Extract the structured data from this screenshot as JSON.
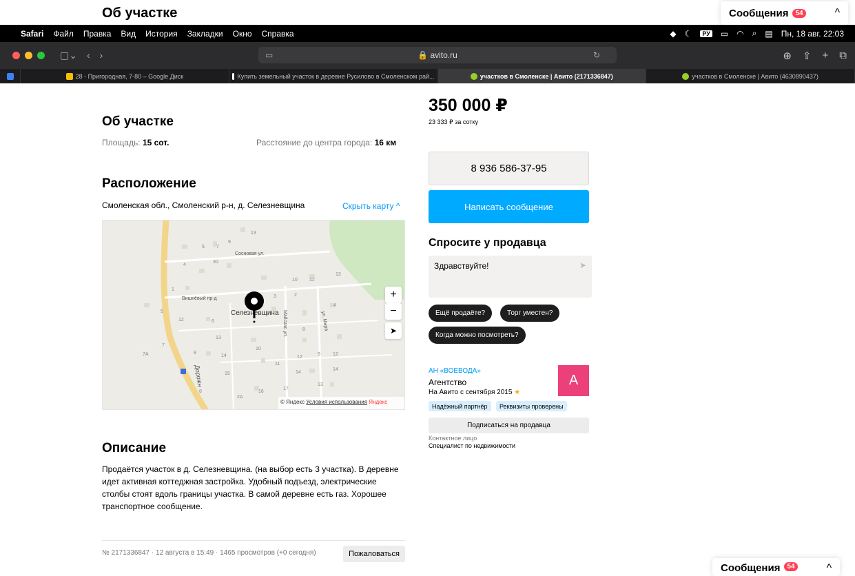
{
  "sticky_header": {
    "title": "Об участке",
    "messages_label": "Сообщения",
    "messages_count": "54",
    "collapse_icon": "chevron-up-icon"
  },
  "menubar": {
    "apple_icon": "apple-icon",
    "app": "Safari",
    "items": [
      "Файл",
      "Правка",
      "Вид",
      "История",
      "Закладки",
      "Окно",
      "Справка"
    ],
    "input_lang": "РУ",
    "datetime": "Пн, 18 авг. 22:03"
  },
  "toolbar": {
    "url": "avito.ru",
    "colors": {
      "close": "#ff5f57",
      "minimize": "#febc2e",
      "zoom": "#28c840"
    }
  },
  "tabs": [
    {
      "label": "28 - Пригородная, 7-80 – Google Диск",
      "active": false
    },
    {
      "label": "Купить земельный участок в деревне Русилово в Смоленском рай...",
      "active": false
    },
    {
      "label": "участков в Смоленске | Авито (2171336847)",
      "active": true
    },
    {
      "label": "участков в Смоленске | Авито (4630890437)",
      "active": false
    }
  ],
  "about": {
    "title": "Об участке",
    "area_label": "Площадь:",
    "area_value": "15 сот.",
    "distance_label": "Расстояние до центра города:",
    "distance_value": "16 км"
  },
  "location": {
    "title": "Расположение",
    "address": "Смоленская обл., Смоленский р-н, д. Селезневщина",
    "hide_map": "Скрыть карту",
    "map": {
      "place_label": "Селезневщина",
      "streets": [
        "Сосновая ул.",
        "Вишнёвый пр-д",
        "Майская ул.",
        "ул. Мира",
        "Дорожн"
      ],
      "house_numbers": [
        "13",
        "9",
        "5",
        "7",
        "30",
        "4",
        "10",
        "11",
        "13",
        "1",
        "2",
        "3",
        "4",
        "5",
        "12",
        "6",
        "8",
        "13",
        "7",
        "7А",
        "8",
        "14",
        "10",
        "11",
        "12",
        "9",
        "12",
        "14",
        "14",
        "15",
        "13",
        "16",
        "17",
        "2А",
        "8"
      ],
      "copyright": "© Яндекс",
      "terms": "Условия использования",
      "brand": "Яндекс",
      "zoom_in": "+",
      "zoom_out": "−"
    }
  },
  "description": {
    "title": "Описание",
    "text": "Продаётся участок в д. Селезневщина. (на выбор есть 3 участка). В деревне идет активная коттеджная застройка. Удобный подъезд, электрические столбы стоят вдоль границы участка. В самой деревне есть газ. Хорошее транспортное сообщение."
  },
  "footer": {
    "info": "№ 2171336847 · 12 августа в 15:49 · 1465 просмотров (+0 сегодня)",
    "complain": "Пожаловаться"
  },
  "sidebar": {
    "price": "350 000 ₽",
    "price_per": "23 333 ₽ за сотку",
    "phone": "8 936 586-37-95",
    "write_button": "Написать сообщение",
    "ask_title": "Спросите у продавца",
    "ask_input": "Здравствуйте!",
    "quick_questions": [
      "Ещё продаёте?",
      "Торг уместен?",
      "Когда можно посмотреть?"
    ],
    "seller": {
      "name": "АН «ВОЕВОДА»",
      "type": "Агентство",
      "since": "На Авито с сентября 2015",
      "avatar_letter": "A",
      "avatar_color": "#ec407a",
      "badges": [
        "Надёжный партнёр",
        "Реквизиты проверены"
      ],
      "subscribe": "Подписаться на продавца",
      "contact_label": "Контактное лицо",
      "contact_value": "Специалист по недвижимости"
    }
  },
  "bottom_messages": {
    "label": "Сообщения",
    "count": "54"
  }
}
